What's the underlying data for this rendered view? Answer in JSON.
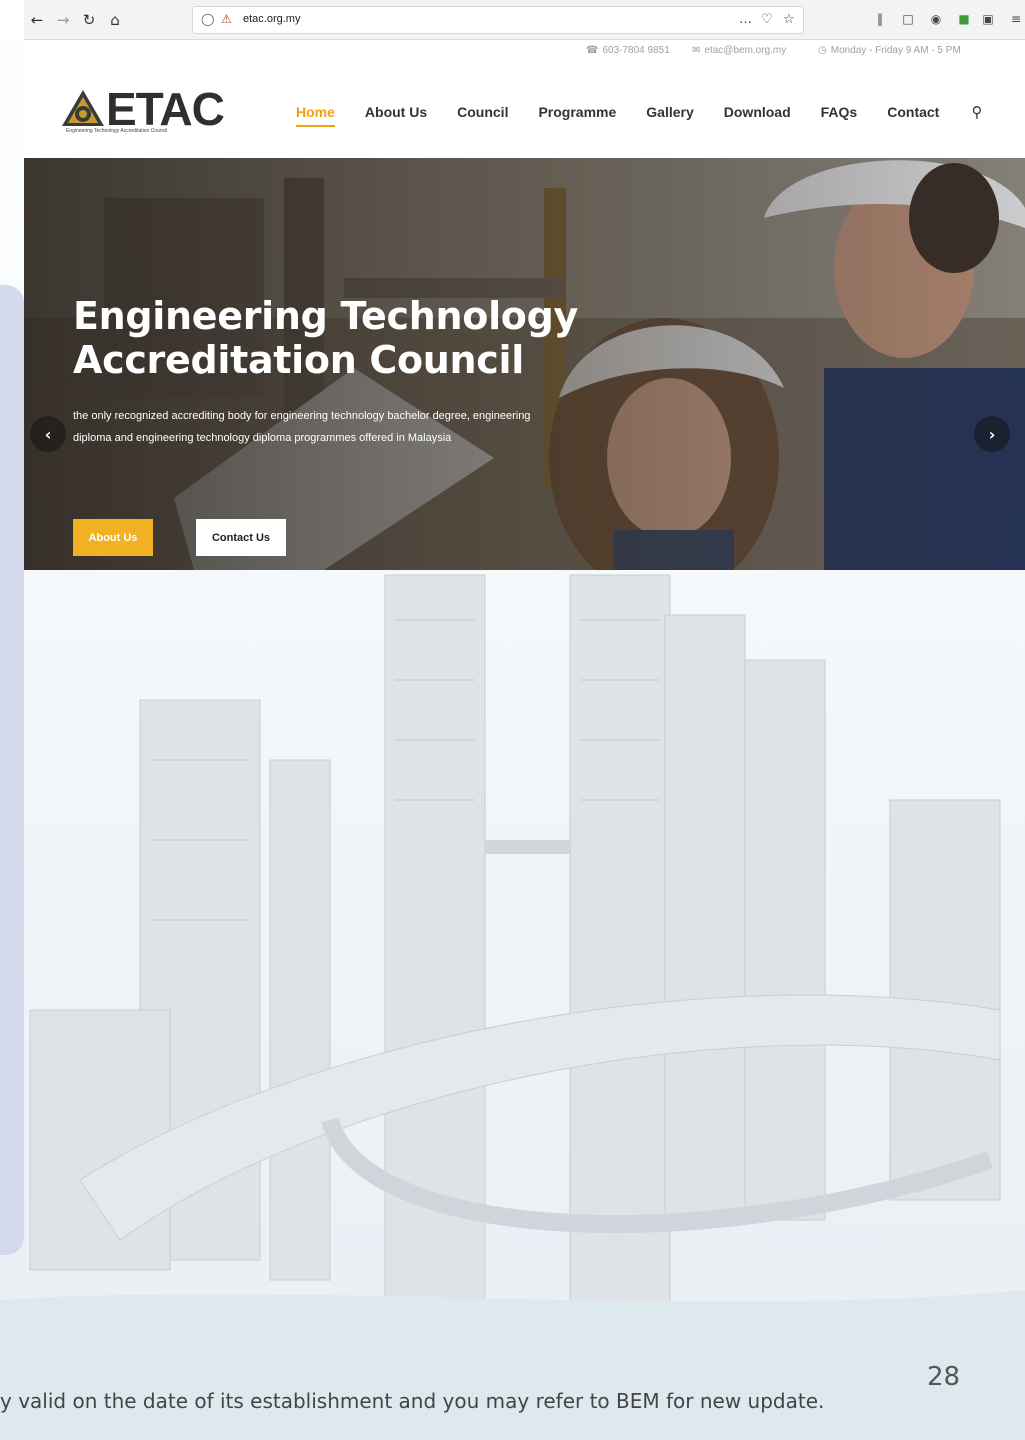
{
  "browser": {
    "back_icon": "back-arrow-icon",
    "forward_icon": "forward-arrow-icon",
    "reload_icon": "reload-icon",
    "home_icon": "home-icon",
    "url": "etac.org.my",
    "more_label": "…"
  },
  "topbar": {
    "phone": "603-7804 9851",
    "email": "etac@bem.org.my",
    "hours": "Monday - Friday 9 AM - 5 PM"
  },
  "logo": {
    "text": "ETAC",
    "tagline": "Engineering Technology Accreditation Council"
  },
  "menu": {
    "items": [
      {
        "label": "Home",
        "active": true
      },
      {
        "label": "About Us"
      },
      {
        "label": "Council"
      },
      {
        "label": "Programme"
      },
      {
        "label": "Gallery"
      },
      {
        "label": "Download"
      },
      {
        "label": "FAQs"
      },
      {
        "label": "Contact"
      }
    ]
  },
  "hero": {
    "title": "Engineering Technology Accreditation Council",
    "subtitle": "the only recognized accrediting body for engineering technology bachelor degree, engineering diploma and engineering technology diploma programmes offered in Malaysia",
    "button_primary": "About Us",
    "button_secondary": "Contact Us"
  },
  "slide": {
    "page_number": "28",
    "footnote": "y valid on the date of its establishment and you may refer to BEM for new update."
  },
  "colors": {
    "accent": "#f2a116",
    "button_yellow": "#f2b122",
    "side_bar": "#d4d9ee"
  }
}
